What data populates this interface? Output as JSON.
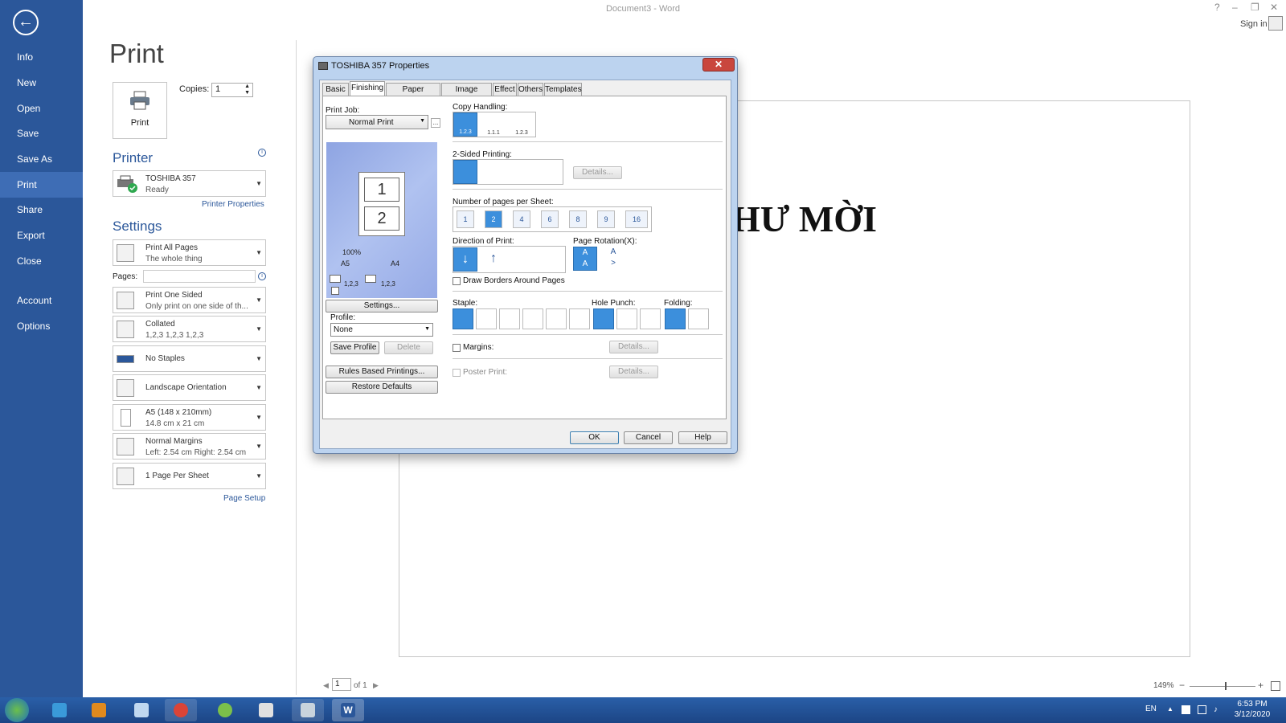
{
  "window": {
    "title": "Document3 - Word",
    "sign_in": "Sign in"
  },
  "backstage": {
    "nav": [
      {
        "label": "Info"
      },
      {
        "label": "New"
      },
      {
        "label": "Open"
      },
      {
        "label": "Save"
      },
      {
        "label": "Save As"
      },
      {
        "label": "Print",
        "selected": true
      },
      {
        "label": "Share"
      },
      {
        "label": "Export"
      },
      {
        "label": "Close"
      },
      {
        "label": "Account"
      },
      {
        "label": "Options"
      }
    ]
  },
  "print": {
    "title": "Print",
    "print_button": "Print",
    "copies_label": "Copies:",
    "copies_value": "1",
    "printer_heading": "Printer",
    "printer_name": "TOSHIBA 357",
    "printer_status": "Ready",
    "printer_properties": "Printer Properties",
    "settings_heading": "Settings",
    "settings": [
      {
        "line1": "Print All Pages",
        "line2": "The whole thing"
      },
      {
        "line1": "Print One Sided",
        "line2": "Only print on one side of th..."
      },
      {
        "line1": "Collated",
        "line2": "1,2,3    1,2,3    1,2,3"
      },
      {
        "line1": "No Staples",
        "line2": ""
      },
      {
        "line1": "Landscape Orientation",
        "line2": ""
      },
      {
        "line1": "A5 (148 x 210mm)",
        "line2": "14.8 cm x 21 cm"
      },
      {
        "line1": "Normal Margins",
        "line2": "Left:  2.54 cm    Right:  2.54 cm"
      },
      {
        "line1": "1 Page Per Sheet",
        "line2": ""
      }
    ],
    "pages_label": "Pages:",
    "page_setup": "Page Setup"
  },
  "document": {
    "heading": "HƯ MỜI",
    "page_current": "1",
    "page_of": "of 1",
    "zoom": "149%"
  },
  "dialog": {
    "title": "TOSHIBA 357 Properties",
    "tabs": [
      "Basic",
      "Finishing",
      "Paper Handling",
      "Image Quality",
      "Effect",
      "Others",
      "Templates"
    ],
    "selected_tab": "Finishing",
    "print_job_label": "Print Job:",
    "print_job_value": "Normal Print",
    "preview_zoom": "100%",
    "preview_size_a": "A5",
    "preview_size_b": "A4",
    "preview_collate_a": "1,2,3",
    "preview_collate_b": "1,2,3",
    "settings_button": "Settings...",
    "profile_label": "Profile:",
    "profile_value": "None",
    "save_profile": "Save Profile",
    "delete": "Delete",
    "rules_based": "Rules Based Printings...",
    "restore_defaults": "Restore Defaults",
    "copy_handling_label": "Copy Handling:",
    "copy_handling_opts": [
      "1.2.3",
      "1.1.1",
      "1.2.3"
    ],
    "two_sided_label": "2-Sided Printing:",
    "details": "Details...",
    "pages_per_sheet_label": "Number of pages per Sheet:",
    "pages_per_sheet": [
      "1",
      "2",
      "4",
      "6",
      "8",
      "9",
      "16"
    ],
    "pages_per_sheet_selected": "2",
    "direction_label": "Direction of Print:",
    "rotation_label": "Page Rotation(X):",
    "draw_borders": "Draw Borders Around Pages",
    "staple_label": "Staple:",
    "hole_punch_label": "Hole Punch:",
    "folding_label": "Folding:",
    "margins_label": "Margins:",
    "poster_label": "Poster Print:",
    "ok": "OK",
    "cancel": "Cancel",
    "help": "Help"
  },
  "taskbar": {
    "lang": "EN",
    "time": "6:53 PM",
    "date": "3/12/2020"
  },
  "colors": {
    "accent": "#2b579a",
    "selected_option": "#3c8fdc",
    "taskbar": "#1c4585"
  }
}
